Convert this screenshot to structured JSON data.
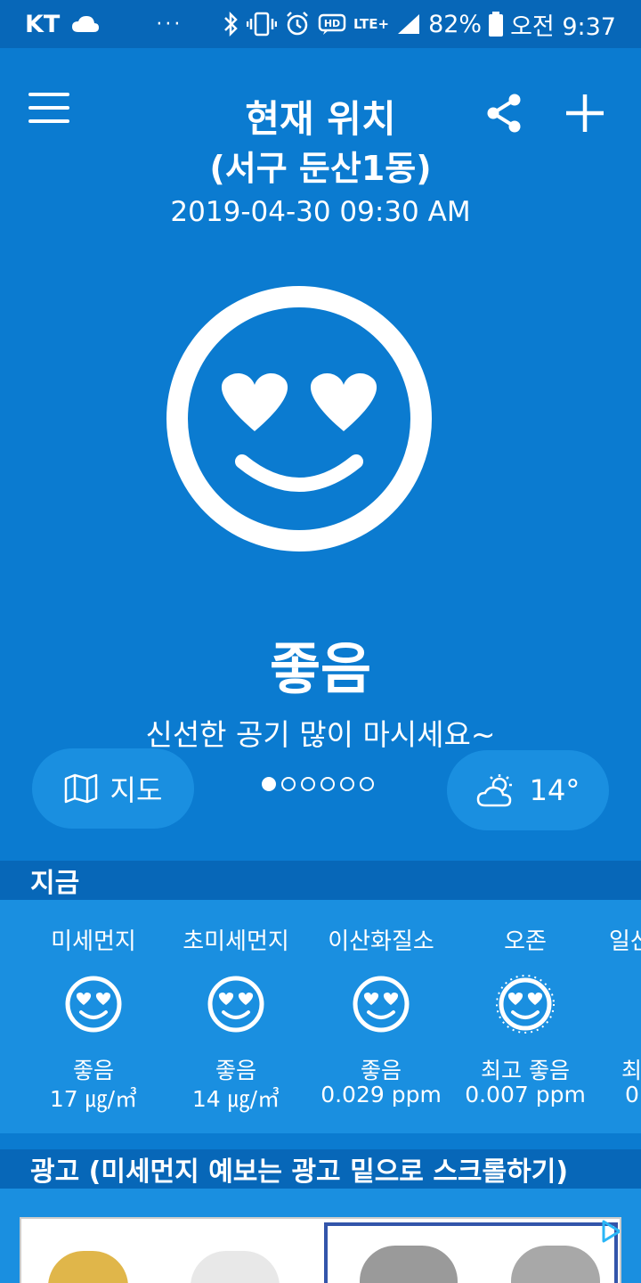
{
  "status_bar": {
    "carrier": "KT",
    "more": "···",
    "network": "LTE+",
    "battery": "82%",
    "time": "오전 9:37"
  },
  "header": {
    "title": "현재 위치",
    "subtitle": "(서구 둔산1동)",
    "timestamp": "2019-04-30 09:30 AM"
  },
  "main": {
    "status_label": "좋음",
    "message": "신선한 공기 많이 마시세요~"
  },
  "controls": {
    "map_label": "지도",
    "temperature": "14°",
    "pager": {
      "count": 6,
      "active_index": 0
    }
  },
  "now_section": {
    "title": "지금",
    "items": [
      {
        "name": "미세먼지",
        "grade": "좋음",
        "value": "17 ㎍/㎥"
      },
      {
        "name": "초미세먼지",
        "grade": "좋음",
        "value": "14 ㎍/㎥"
      },
      {
        "name": "이산화질소",
        "grade": "좋음",
        "value": "0.029 ppm"
      },
      {
        "name": "오존",
        "grade": "최고 좋음",
        "value": "0.007 ppm"
      },
      {
        "name": "일산",
        "grade": "최",
        "value": "0."
      }
    ]
  },
  "ad_section": {
    "title": "광고 (미세먼지 예보는 광고 밑으로 스크롤하기)"
  },
  "colors": {
    "background": "#0b7bd0",
    "panel": "#1a8fe0",
    "header_bar": "#0767b8"
  }
}
